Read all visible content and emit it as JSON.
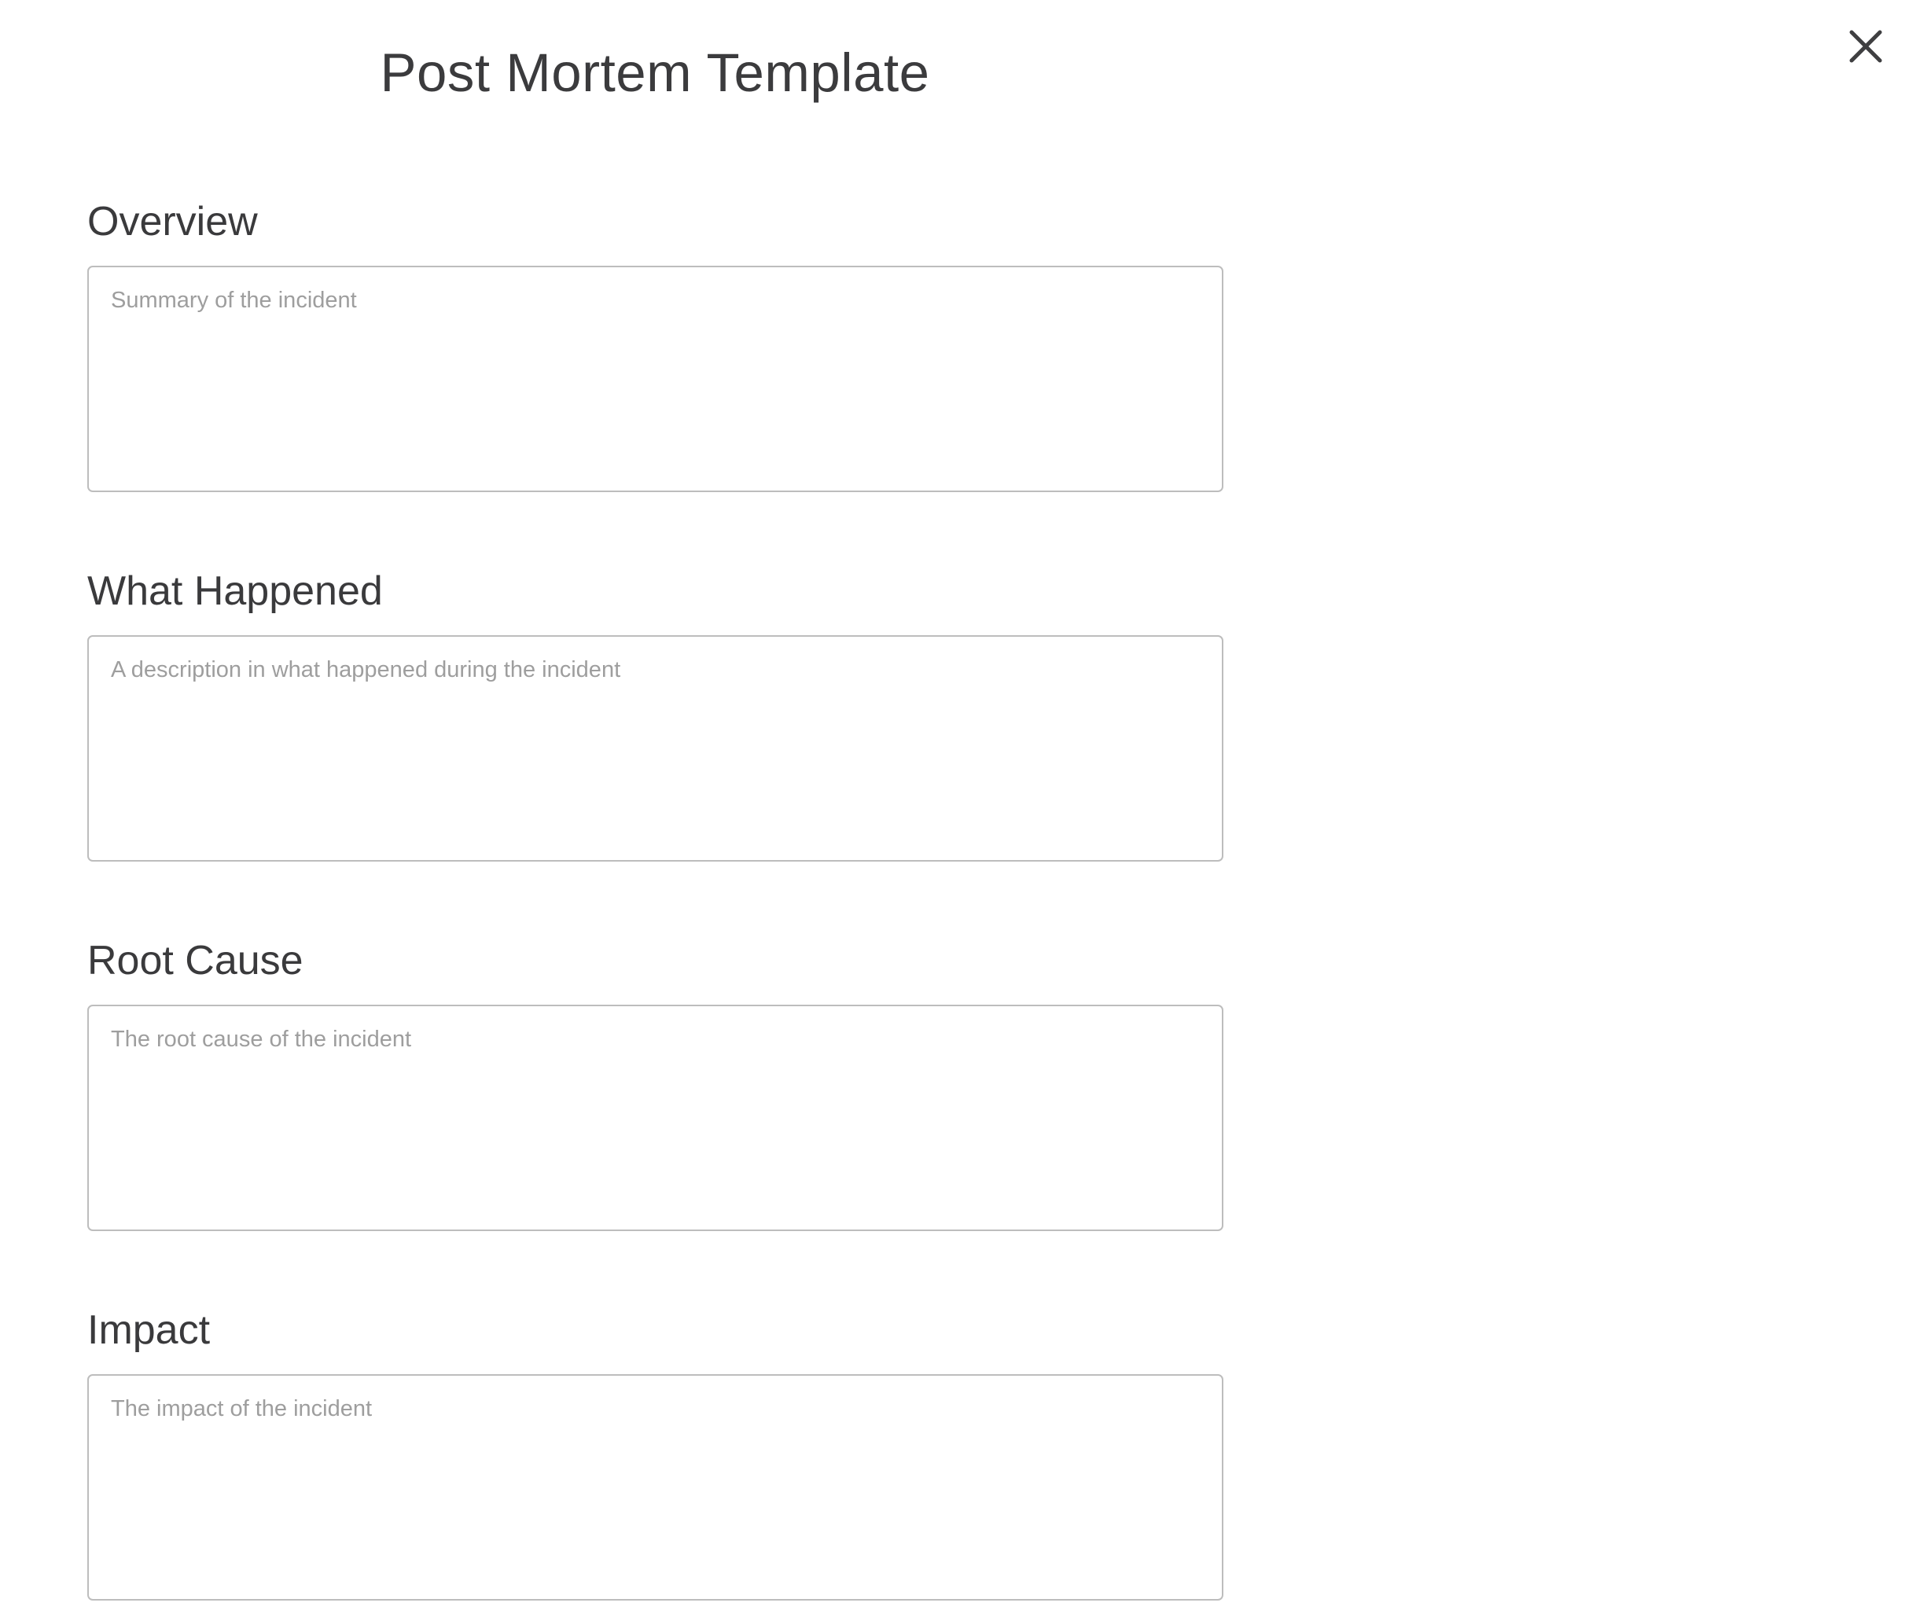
{
  "dialog": {
    "title": "Post Mortem Template",
    "close_icon": "close-icon"
  },
  "sections": [
    {
      "label": "Overview",
      "value": "",
      "placeholder": "Summary of the incident"
    },
    {
      "label": "What Happened",
      "value": "",
      "placeholder": "A description in what happened during the incident"
    },
    {
      "label": "Root Cause",
      "value": "",
      "placeholder": "The root cause of the incident"
    },
    {
      "label": "Impact",
      "value": "",
      "placeholder": "The impact of the incident"
    }
  ],
  "colors": {
    "text": "#3a3a3c",
    "placeholder": "#9e9e9e",
    "border": "#bdbdbd",
    "background": "#ffffff"
  }
}
